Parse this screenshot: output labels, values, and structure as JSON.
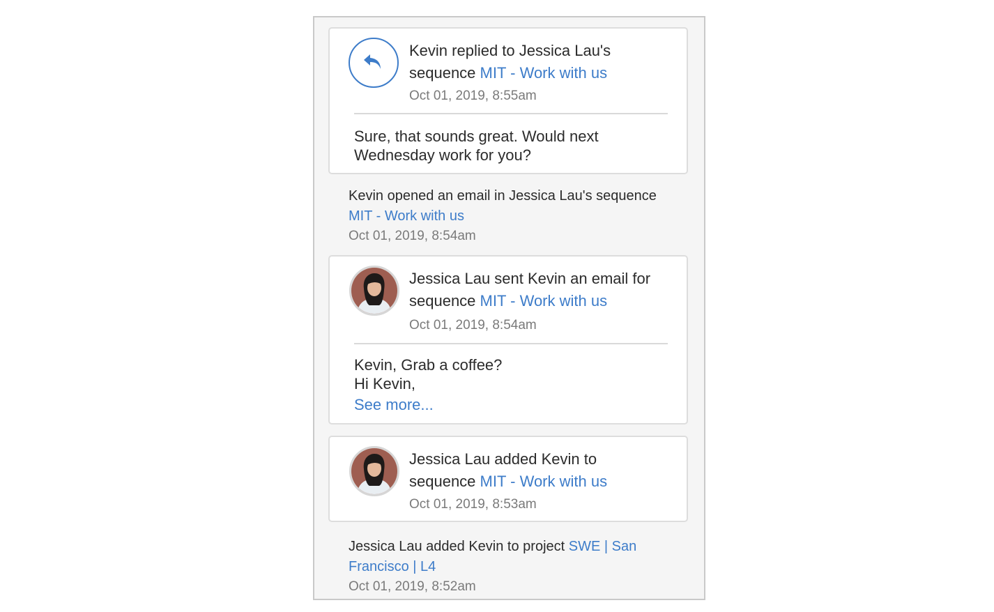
{
  "feed": {
    "card_reply": {
      "icon": "reply-icon",
      "title_prefix": "Kevin replied to Jessica Lau's sequence",
      "link": "MIT - Work with us",
      "time": "Oct 01, 2019, 8:55am",
      "body": "Sure, that sounds great. Would next Wednesday work for you?"
    },
    "event_opened": {
      "text_prefix": "Kevin opened an email in Jessica Lau's sequence",
      "link": "MIT - Work with us",
      "time": "Oct 01, 2019, 8:54am"
    },
    "card_sent": {
      "title_prefix": "Jessica Lau sent Kevin an email for sequence",
      "link": "MIT - Work with us",
      "time": "Oct 01, 2019, 8:54am",
      "subject": "Kevin, Grab a coffee?",
      "greeting": "Hi Kevin,",
      "see_more": "See more..."
    },
    "card_added": {
      "title_prefix": "Jessica Lau added Kevin to sequence",
      "link": "MIT - Work with us",
      "time": "Oct 01, 2019, 8:53am"
    },
    "event_project": {
      "text_prefix": "Jessica Lau added Kevin to project",
      "link": "SWE | San Francisco | L4",
      "time": "Oct 01, 2019, 8:52am"
    }
  },
  "colors": {
    "link": "#3d7cc9",
    "muted_text": "#7a7a7a",
    "panel_background": "#f5f5f5"
  }
}
